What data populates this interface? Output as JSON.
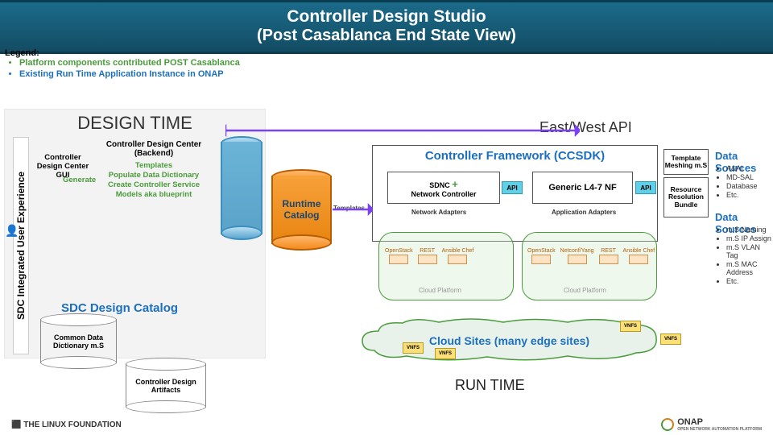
{
  "header": {
    "line1": "Controller Design Studio",
    "line2": "(Post Casablanca End State View)"
  },
  "legend": {
    "title": "Legend:",
    "item1": "Platform components contributed POST Casablanca",
    "item2": "Existing Run Time Application Instance in ONAP"
  },
  "designTime": {
    "title": "DESIGN TIME",
    "sdcLabel": "SDC Integrated User Experience",
    "controllerGui": "Controller Design Center GUI",
    "backendTitle": "Controller Design Center (Backend)",
    "generate": "Generate",
    "backendLines": [
      "Templates",
      "Populate Data Dictionary",
      "Create Controller Service Models aka blueprint"
    ],
    "catalogTitle": "SDC Design Catalog",
    "dictLabel": "Common Data\nDictionary\nm.S",
    "artLabel": "Controller\nDesign\nArtifacts"
  },
  "runtimeCatalog": "Runtime\nCatalog",
  "templatesLabel": "Templates",
  "eastWest": "East/West API",
  "ccsdk": {
    "title": "Controller Framework (CCSDK)",
    "sdncLine1": "SDNC ",
    "sdncPlus": "+",
    "sdncLine2": "Network Controller",
    "generic": "Generic L4-7 NF",
    "api": "API",
    "netAdapters": "Network Adapters",
    "appAdapters": "Application Adapters",
    "cloudPlatform": "Cloud Platform"
  },
  "stackNames": [
    "OpenStack",
    "REST",
    "Ansible Chef",
    "OpenStack",
    "Netconf/Yang",
    "REST",
    "Ansible Chef"
  ],
  "cloudSites": "Cloud Sites (many edge sites)",
  "vnf": "VNFS",
  "runtimeLabel": "RUN TIME",
  "meshing": "Template Meshing m.S",
  "resolution": "Resource Resolution Bundle",
  "dsTitle": "Data Sources",
  "dsList1": [
    "A&AI",
    "MD-SAL",
    "Database",
    "Etc."
  ],
  "dsList2": [
    "m.S Naming",
    "m.S IP Assign",
    "m.S VLAN Tag",
    "m.S MAC Address",
    "Etc."
  ],
  "footer": {
    "linux": "THE LINUX FOUNDATION",
    "onap1": "ONAP",
    "onap2": "OPEN NETWORK AUTOMATION PLATFORM"
  },
  "icons": {
    "user": "👤"
  }
}
